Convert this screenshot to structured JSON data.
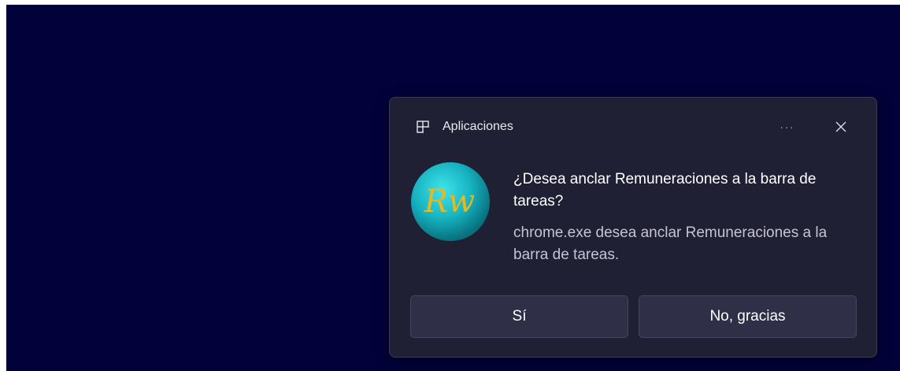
{
  "toast": {
    "app_name": "Aplicaciones",
    "more_label": "···",
    "title": "¿Desea anclar Remuneraciones a la barra de tareas?",
    "body": "chrome.exe desea anclar Remuneraciones a la barra de tareas.",
    "logo_text": "Rw",
    "yes_label": "Sí",
    "no_label": "No, gracias"
  },
  "colors": {
    "desktop": "#02023a",
    "toast_bg": "#202035",
    "button_bg": "#2f2f47",
    "logo_teal": "#19b8c4",
    "logo_text": "#e8b81e"
  },
  "icons": {
    "app": "apps-grid-icon",
    "more": "more-dots-icon",
    "close": "close-icon"
  }
}
